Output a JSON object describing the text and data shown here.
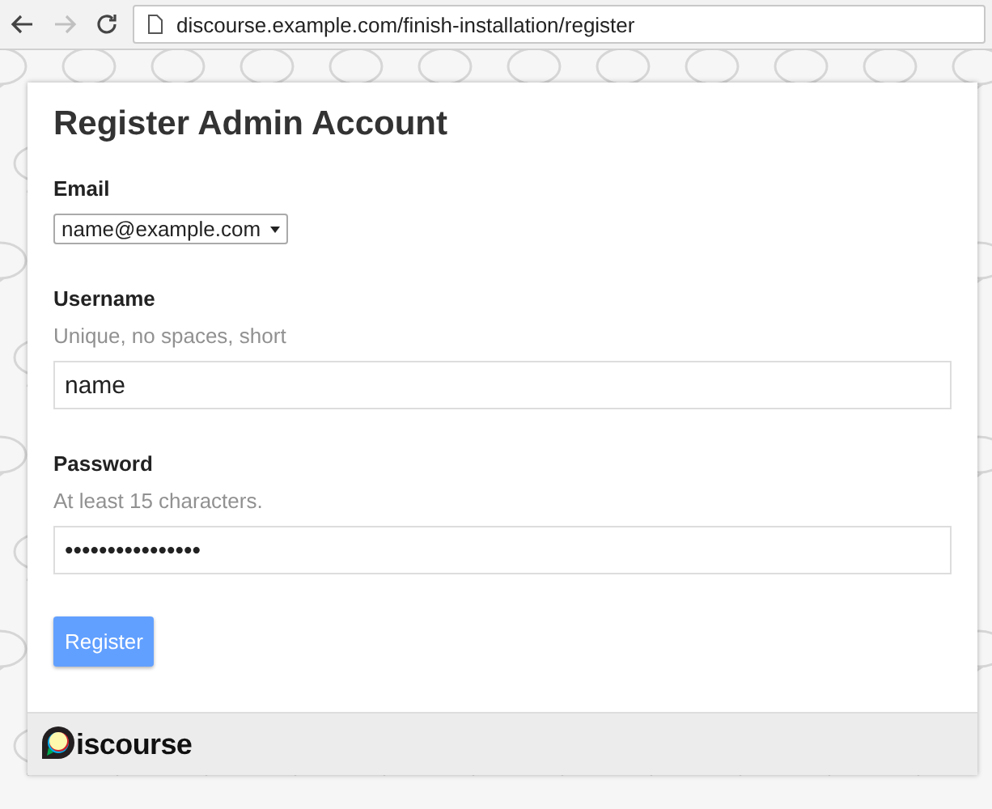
{
  "browser": {
    "back_enabled": true,
    "forward_enabled": false,
    "url": "discourse.example.com/finish-installation/register"
  },
  "form": {
    "title": "Register Admin Account",
    "fields": [
      {
        "kind": "select",
        "label": "Email",
        "value": "name@example.com"
      },
      {
        "kind": "text",
        "label": "Username",
        "hint": "Unique, no spaces, short",
        "value": "name"
      },
      {
        "kind": "text",
        "label": "Password",
        "hint": "At least 15 characters.",
        "value": "••••••••••••••••"
      }
    ],
    "submit": "Register"
  },
  "footer": {
    "logo_text": "iscourse"
  }
}
